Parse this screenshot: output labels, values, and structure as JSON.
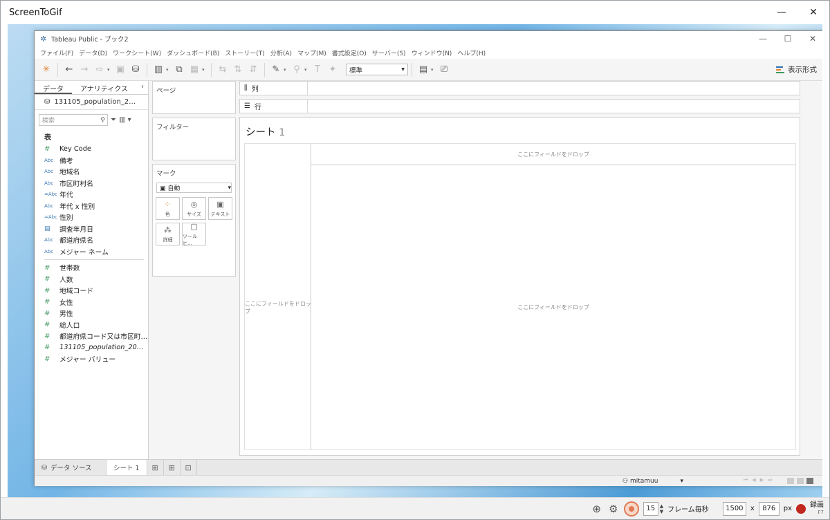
{
  "app": {
    "title": "ScreenToGif",
    "minimize": "—",
    "close": "✕"
  },
  "tableau": {
    "title": "Tableau Public - ブック2",
    "minimize": "—",
    "maximize": "☐",
    "close": "✕",
    "menu": [
      "ファイル(F)",
      "データ(D)",
      "ワークシート(W)",
      "ダッシュボード(B)",
      "ストーリー(T)",
      "分析(A)",
      "マップ(M)",
      "書式設定(O)",
      "サーバー(S)",
      "ウィンドウ(N)",
      "ヘルプ(H)"
    ],
    "toolbar": {
      "fit_select": "標準",
      "show_me": "表示形式"
    },
    "data_pane": {
      "tab_data": "データ",
      "tab_analytics": "アナリティクス",
      "collapse": "‹",
      "datasource": "131105_population_2…",
      "search_placeholder": "検索",
      "section_label": "表",
      "dimensions": [
        {
          "type": "#",
          "name": "Key Code"
        },
        {
          "type": "Abc",
          "name": "備考"
        },
        {
          "type": "Abc",
          "name": "地域名"
        },
        {
          "type": "Abc",
          "name": "市区町村名"
        },
        {
          "type": "=Abc",
          "name": "年代"
        },
        {
          "type": "Abc",
          "name": "年代 x 性別"
        },
        {
          "type": "=Abc",
          "name": "性別"
        },
        {
          "type": "cal",
          "name": "調査年月日"
        },
        {
          "type": "Abc",
          "name": "都道府県名"
        },
        {
          "type": "Abc",
          "name": "メジャー ネーム"
        }
      ],
      "measures": [
        {
          "type": "#",
          "name": "世帯数"
        },
        {
          "type": "#",
          "name": "人数"
        },
        {
          "type": "#",
          "name": "地域コード"
        },
        {
          "type": "#",
          "name": "女性"
        },
        {
          "type": "#",
          "name": "男性"
        },
        {
          "type": "#",
          "name": "総人口"
        },
        {
          "type": "#",
          "name": "都道府県コード又は市区町…"
        },
        {
          "type": "#",
          "name": "131105_population_20…",
          "italic": true
        },
        {
          "type": "#",
          "name": "メジャー バリュー"
        }
      ]
    },
    "shelves": {
      "pages": "ページ",
      "filters": "フィルター",
      "marks": "マーク",
      "marks_type": "自動",
      "mark_buttons": [
        "色",
        "サイズ",
        "テキスト",
        "詳細",
        "ツールヒ…"
      ],
      "columns": "列",
      "rows": "行"
    },
    "sheet": {
      "title_prefix": "シート",
      "title_number": "1",
      "drop_here": "ここにフィールドをドロップ"
    },
    "tabs": {
      "datasource": "データ ソース",
      "sheet1": "シート 1"
    },
    "status": {
      "user": "mitamuu"
    }
  },
  "recorder": {
    "fps": "15",
    "fps_label": "フレーム毎秒",
    "width": "1500",
    "times": "x",
    "height": "876",
    "unit": "px",
    "record_label": "録画",
    "record_shortcut": "F7"
  }
}
